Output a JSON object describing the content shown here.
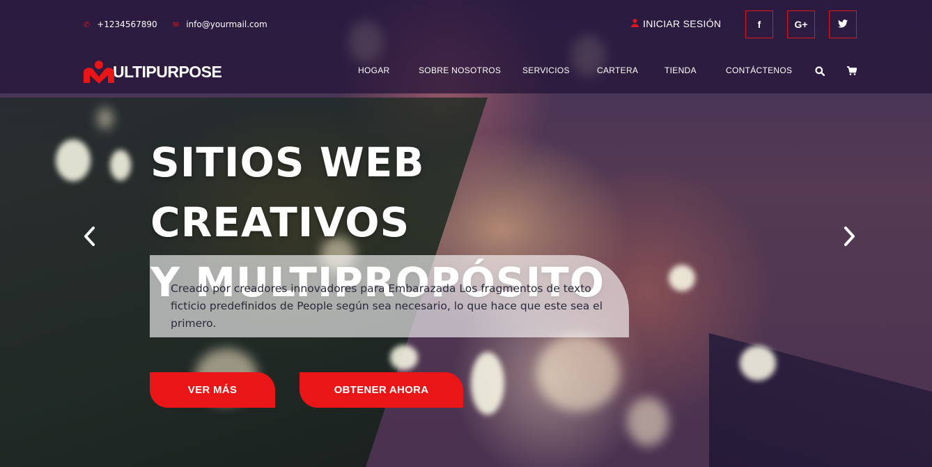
{
  "topbar": {
    "phone": "+1234567890",
    "email": "info@yourmail.com",
    "login": "INICIAR SESIÓN",
    "social": [
      "f",
      "G+",
      "t"
    ]
  },
  "brand": {
    "logo_text": "ULTIPURPOSE"
  },
  "nav": {
    "items": [
      "HOGAR",
      "SOBRE NOSOTROS",
      "SERVICIOS",
      "CARTERA",
      "TIENDA",
      "CONTÁCTENOS"
    ]
  },
  "hero": {
    "title_line1": "SITIOS WEB CREATIVOS",
    "title_line2": "Y MULTIPROPÓSITO",
    "description_line1": "Creado por creadores innovadores para Embarazada Los fragmentos de texto",
    "description_line2": "ficticio predefinidos de People según sea necesario, lo que hace que este sea el primero.",
    "button_primary": "VER MÁS",
    "button_secondary": "OBTENER AHORA"
  },
  "colors": {
    "accent": "#ea1517",
    "header_bg": "#231437"
  },
  "icons": {
    "phone": "phone-icon",
    "email": "envelope-icon",
    "user": "user-icon",
    "search": "search-icon",
    "cart": "cart-icon",
    "prev": "chevron-left-icon",
    "next": "chevron-right-icon"
  }
}
